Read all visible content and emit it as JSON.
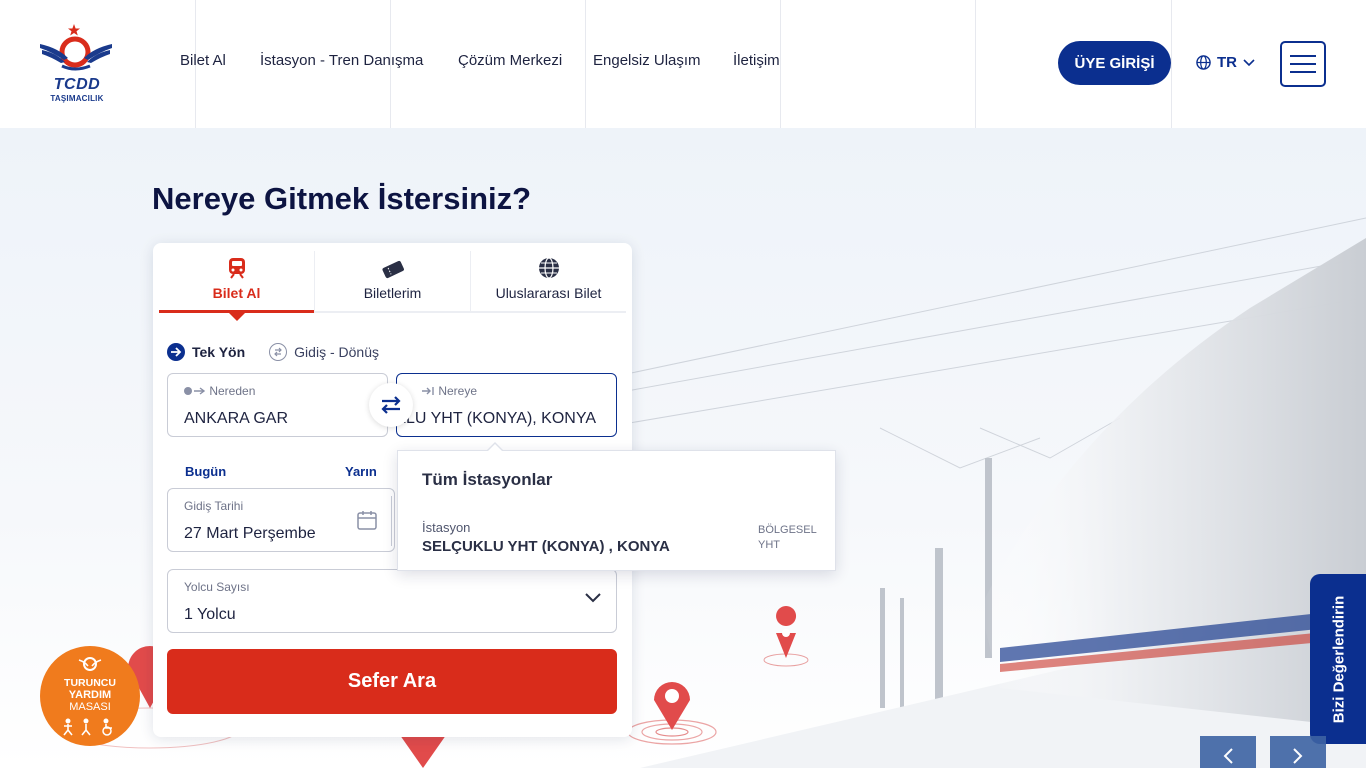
{
  "brand": {
    "logo_text": "TCDD",
    "logo_sub": "TAŞIMACILIK"
  },
  "nav": [
    "Bilet Al",
    "İstasyon - Tren Danışma",
    "Çözüm Merkezi",
    "Engelsiz Ulaşım",
    "İletişim"
  ],
  "header": {
    "login_label": "ÜYE GİRİŞİ",
    "lang": "TR"
  },
  "page_title": "Nereye Gitmek İstersiniz?",
  "tabs": [
    {
      "label": "Bilet Al",
      "icon": "train-icon",
      "active": true
    },
    {
      "label": "Biletlerim",
      "icon": "ticket-icon",
      "active": false
    },
    {
      "label": "Uluslararası Bilet",
      "icon": "globe-icon",
      "active": false
    }
  ],
  "trip_type": {
    "one_way": "Tek Yön",
    "round_trip": "Gidiş - Dönüş",
    "selected": "one_way"
  },
  "from": {
    "label": "Nereden",
    "value": "ANKARA GAR"
  },
  "to": {
    "label": "Nereye",
    "value": "SELÇUKLU YHT (KONYA), KONYA"
  },
  "date": {
    "today": "Bugün",
    "tomorrow": "Yarın",
    "label": "Gidiş Tarihi",
    "value": "27 Mart Perşembe"
  },
  "passengers": {
    "label": "Yolcu Sayısı",
    "value": "1 Yolcu"
  },
  "search_label": "Sefer Ara",
  "dropdown": {
    "title": "Tüm İstasyonlar",
    "items": [
      {
        "kind": "İstasyon",
        "name": "SELÇUKLU YHT (KONYA) , KONYA",
        "type_line1": "BÖLGESEL",
        "type_line2": "YHT"
      }
    ]
  },
  "feedback_label": "Bizi Değerlendirin",
  "helpdesk": {
    "line1": "TURUNCU",
    "line2": "YARDIM",
    "line3": "MASASI"
  },
  "colors": {
    "primary": "#0b2f8f",
    "accent": "#d92c1b",
    "helpdesk": "#f07b1d"
  }
}
